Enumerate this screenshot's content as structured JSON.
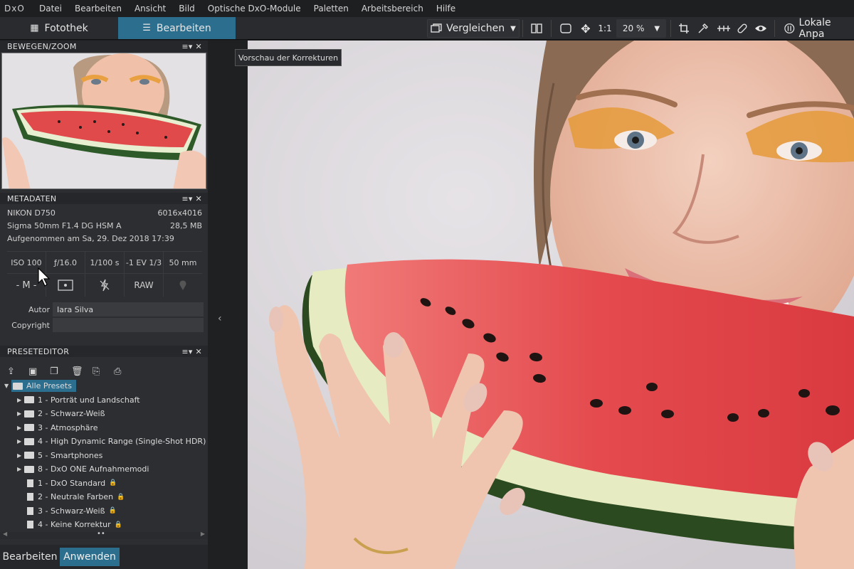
{
  "menubar": {
    "logo": "DxO",
    "items": [
      "Datei",
      "Bearbeiten",
      "Ansicht",
      "Bild",
      "Optische DxO-Module",
      "Paletten",
      "Arbeitsbereich",
      "Hilfe"
    ]
  },
  "toolbar": {
    "tab_library": "Fotothek",
    "tab_edit": "Bearbeiten",
    "compare_label": "Vergleichen",
    "ratio_label": "1:1",
    "zoom_value": "20 %",
    "local_label": "Lokale Anpa"
  },
  "panels": {
    "move_zoom": {
      "title": "BEWEGEN/ZOOM"
    },
    "metadata": {
      "title": "METADATEN",
      "camera": "NIKON D750",
      "dimensions": "6016x4016",
      "lens": "Sigma 50mm F1.4 DG HSM A",
      "filesize": "28,5 MB",
      "taken": "Aufgenommen am Sa, 29. Dez 2018 17:39",
      "iso": "ISO 100",
      "aperture": "ƒ/16.0",
      "shutter": "1/100 s",
      "exposure": "-1 EV 1/3",
      "focal": "50 mm",
      "mode": "- M -",
      "format": "RAW",
      "author_label": "Autor",
      "author_value": "Iara Silva",
      "copyright_label": "Copyright",
      "copyright_value": ""
    },
    "preset_editor": {
      "title": "PRESETEDITOR",
      "root": "Alle Presets",
      "folders": [
        "1 - Porträt und Landschaft",
        "2 - Schwarz-Weiß",
        "3 - Atmosphäre",
        "4 - High Dynamic Range (Single-Shot HDR)",
        "5 - Smartphones",
        "8 - DxO ONE Aufnahmemodi"
      ],
      "presets": [
        "1 - DxO Standard",
        "2 - Neutrale Farben",
        "3 - Schwarz-Weiß",
        "4 - Keine Korrektur"
      ]
    }
  },
  "bottom": {
    "edit_label": "Bearbeiten",
    "apply_label": "Anwenden"
  },
  "tooltip": "Vorschau der Korrekturen",
  "colors": {
    "accent": "#2c6e8e",
    "panel_bg": "#2d2e31",
    "viewer_bg": "#dedbdf"
  }
}
